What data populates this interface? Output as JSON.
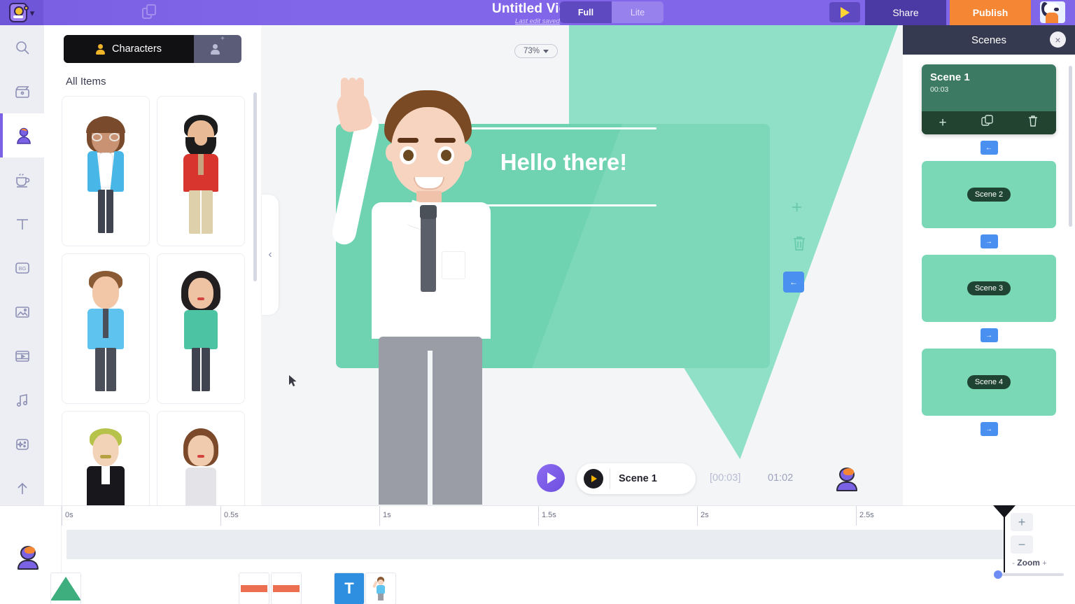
{
  "topbar": {
    "logo_name": "monster-logo",
    "title": "Untitled Video",
    "save_status": "Last edit saved",
    "mode_full": "Full",
    "mode_lite": "Lite",
    "share_label": "Share",
    "publish_label": "Publish",
    "accent_purple": "#7B61E4",
    "publish_orange": "#f58634"
  },
  "rail": {
    "items": [
      {
        "name": "search-icon",
        "label": "Search",
        "active": false
      },
      {
        "name": "scenes-icon",
        "label": "Scenes",
        "active": false
      },
      {
        "name": "characters-icon",
        "label": "Characters",
        "active": true
      },
      {
        "name": "props-icon",
        "label": "Props",
        "active": false
      },
      {
        "name": "text-icon",
        "label": "T",
        "active": false
      },
      {
        "name": "background-icon",
        "label": "BG",
        "active": false
      },
      {
        "name": "image-icon",
        "label": "Images",
        "active": false
      },
      {
        "name": "video-icon",
        "label": "Video",
        "active": false
      },
      {
        "name": "music-icon",
        "label": "Music",
        "active": false
      },
      {
        "name": "effects-icon",
        "label": "Effects",
        "active": false
      },
      {
        "name": "upload-icon",
        "label": "Upload",
        "active": false
      }
    ]
  },
  "library": {
    "tab_label": "Characters",
    "add_tab_name": "add-character-tab",
    "section_title": "All Items",
    "characters": [
      {
        "name": "woman-glasses-blue-cardigan",
        "hair": "#7a4a2c",
        "skin": "#c99272",
        "top": "#49b6e8",
        "bottom": "#3f4450"
      },
      {
        "name": "bearded-man-red-shirt",
        "hair": "#1c1c1c",
        "skin": "#e8bb96",
        "top": "#d8352f",
        "bottom": "#ded0ab"
      },
      {
        "name": "man-blue-shirt-tie",
        "hair": "#8a5a34",
        "skin": "#f1c7a8",
        "top": "#5fc3ef",
        "bottom": "#4a4f59"
      },
      {
        "name": "woman-dark-curly-green-top",
        "hair": "#231f20",
        "skin": "#eec3a4",
        "top": "#4cc4a3",
        "bottom": "#3f4450"
      },
      {
        "name": "man-blond-black-suit",
        "hair": "#b7c24a",
        "skin": "#f3d3b8",
        "top": "#17171c",
        "bottom": "#17171c"
      },
      {
        "name": "woman-brown-hair-white-dress",
        "hair": "#7c4a2a",
        "skin": "#f0cbae",
        "top": "#e4e4e8",
        "bottom": "#e4e4e8"
      }
    ]
  },
  "stage": {
    "zoom_level": "73%",
    "board_text": "Hello there!",
    "board_color": "#6fd3b2",
    "bg_shape_color": "#8fe0c6",
    "character_name": "waving-man-white-shirt",
    "tools": [
      {
        "name": "add-element-icon",
        "label": "+"
      },
      {
        "name": "delete-element-icon",
        "label": "trash"
      },
      {
        "name": "transition-in-button",
        "label": "←"
      }
    ],
    "collapse_handle": "‹"
  },
  "playbar": {
    "play_label": "play",
    "scene_label": "Scene 1",
    "current_time": "[00:03]",
    "total_time": "01:02",
    "icons": [
      {
        "name": "character-settings-icon"
      },
      {
        "name": "scene-settings-icon"
      },
      {
        "name": "focus-frame-icon"
      }
    ]
  },
  "scenes": {
    "panel_title": "Scenes",
    "close_label": "×",
    "items": [
      {
        "name": "scene-card-1",
        "title": "Scene 1",
        "duration": "00:03",
        "active": true,
        "actions": [
          {
            "name": "add-scene-button",
            "label": "+"
          },
          {
            "name": "duplicate-scene-button",
            "label": "copy"
          },
          {
            "name": "delete-scene-button",
            "label": "trash"
          }
        ]
      },
      {
        "name": "scene-card-2",
        "title": "Scene 2",
        "active": false
      },
      {
        "name": "scene-card-3",
        "title": "Scene 3",
        "active": false
      },
      {
        "name": "scene-card-4",
        "title": "Scene 4",
        "active": false
      }
    ],
    "transitions": [
      "←",
      "→",
      "→",
      "→"
    ]
  },
  "timeline": {
    "ticks": [
      "0s",
      "0.5s",
      "1s",
      "1.5s",
      "2s",
      "2.5s"
    ],
    "zoom_label": "Zoom",
    "zoom_minus": "-",
    "zoom_plus": "+",
    "zoom_in_button": "+",
    "zoom_out_button": "−",
    "thumbs": [
      {
        "name": "thumb-background"
      },
      {
        "name": "thumb-audio-clip-1"
      },
      {
        "name": "thumb-audio-clip-2"
      },
      {
        "name": "thumb-text-element",
        "label": "T"
      },
      {
        "name": "thumb-character-element"
      }
    ]
  }
}
